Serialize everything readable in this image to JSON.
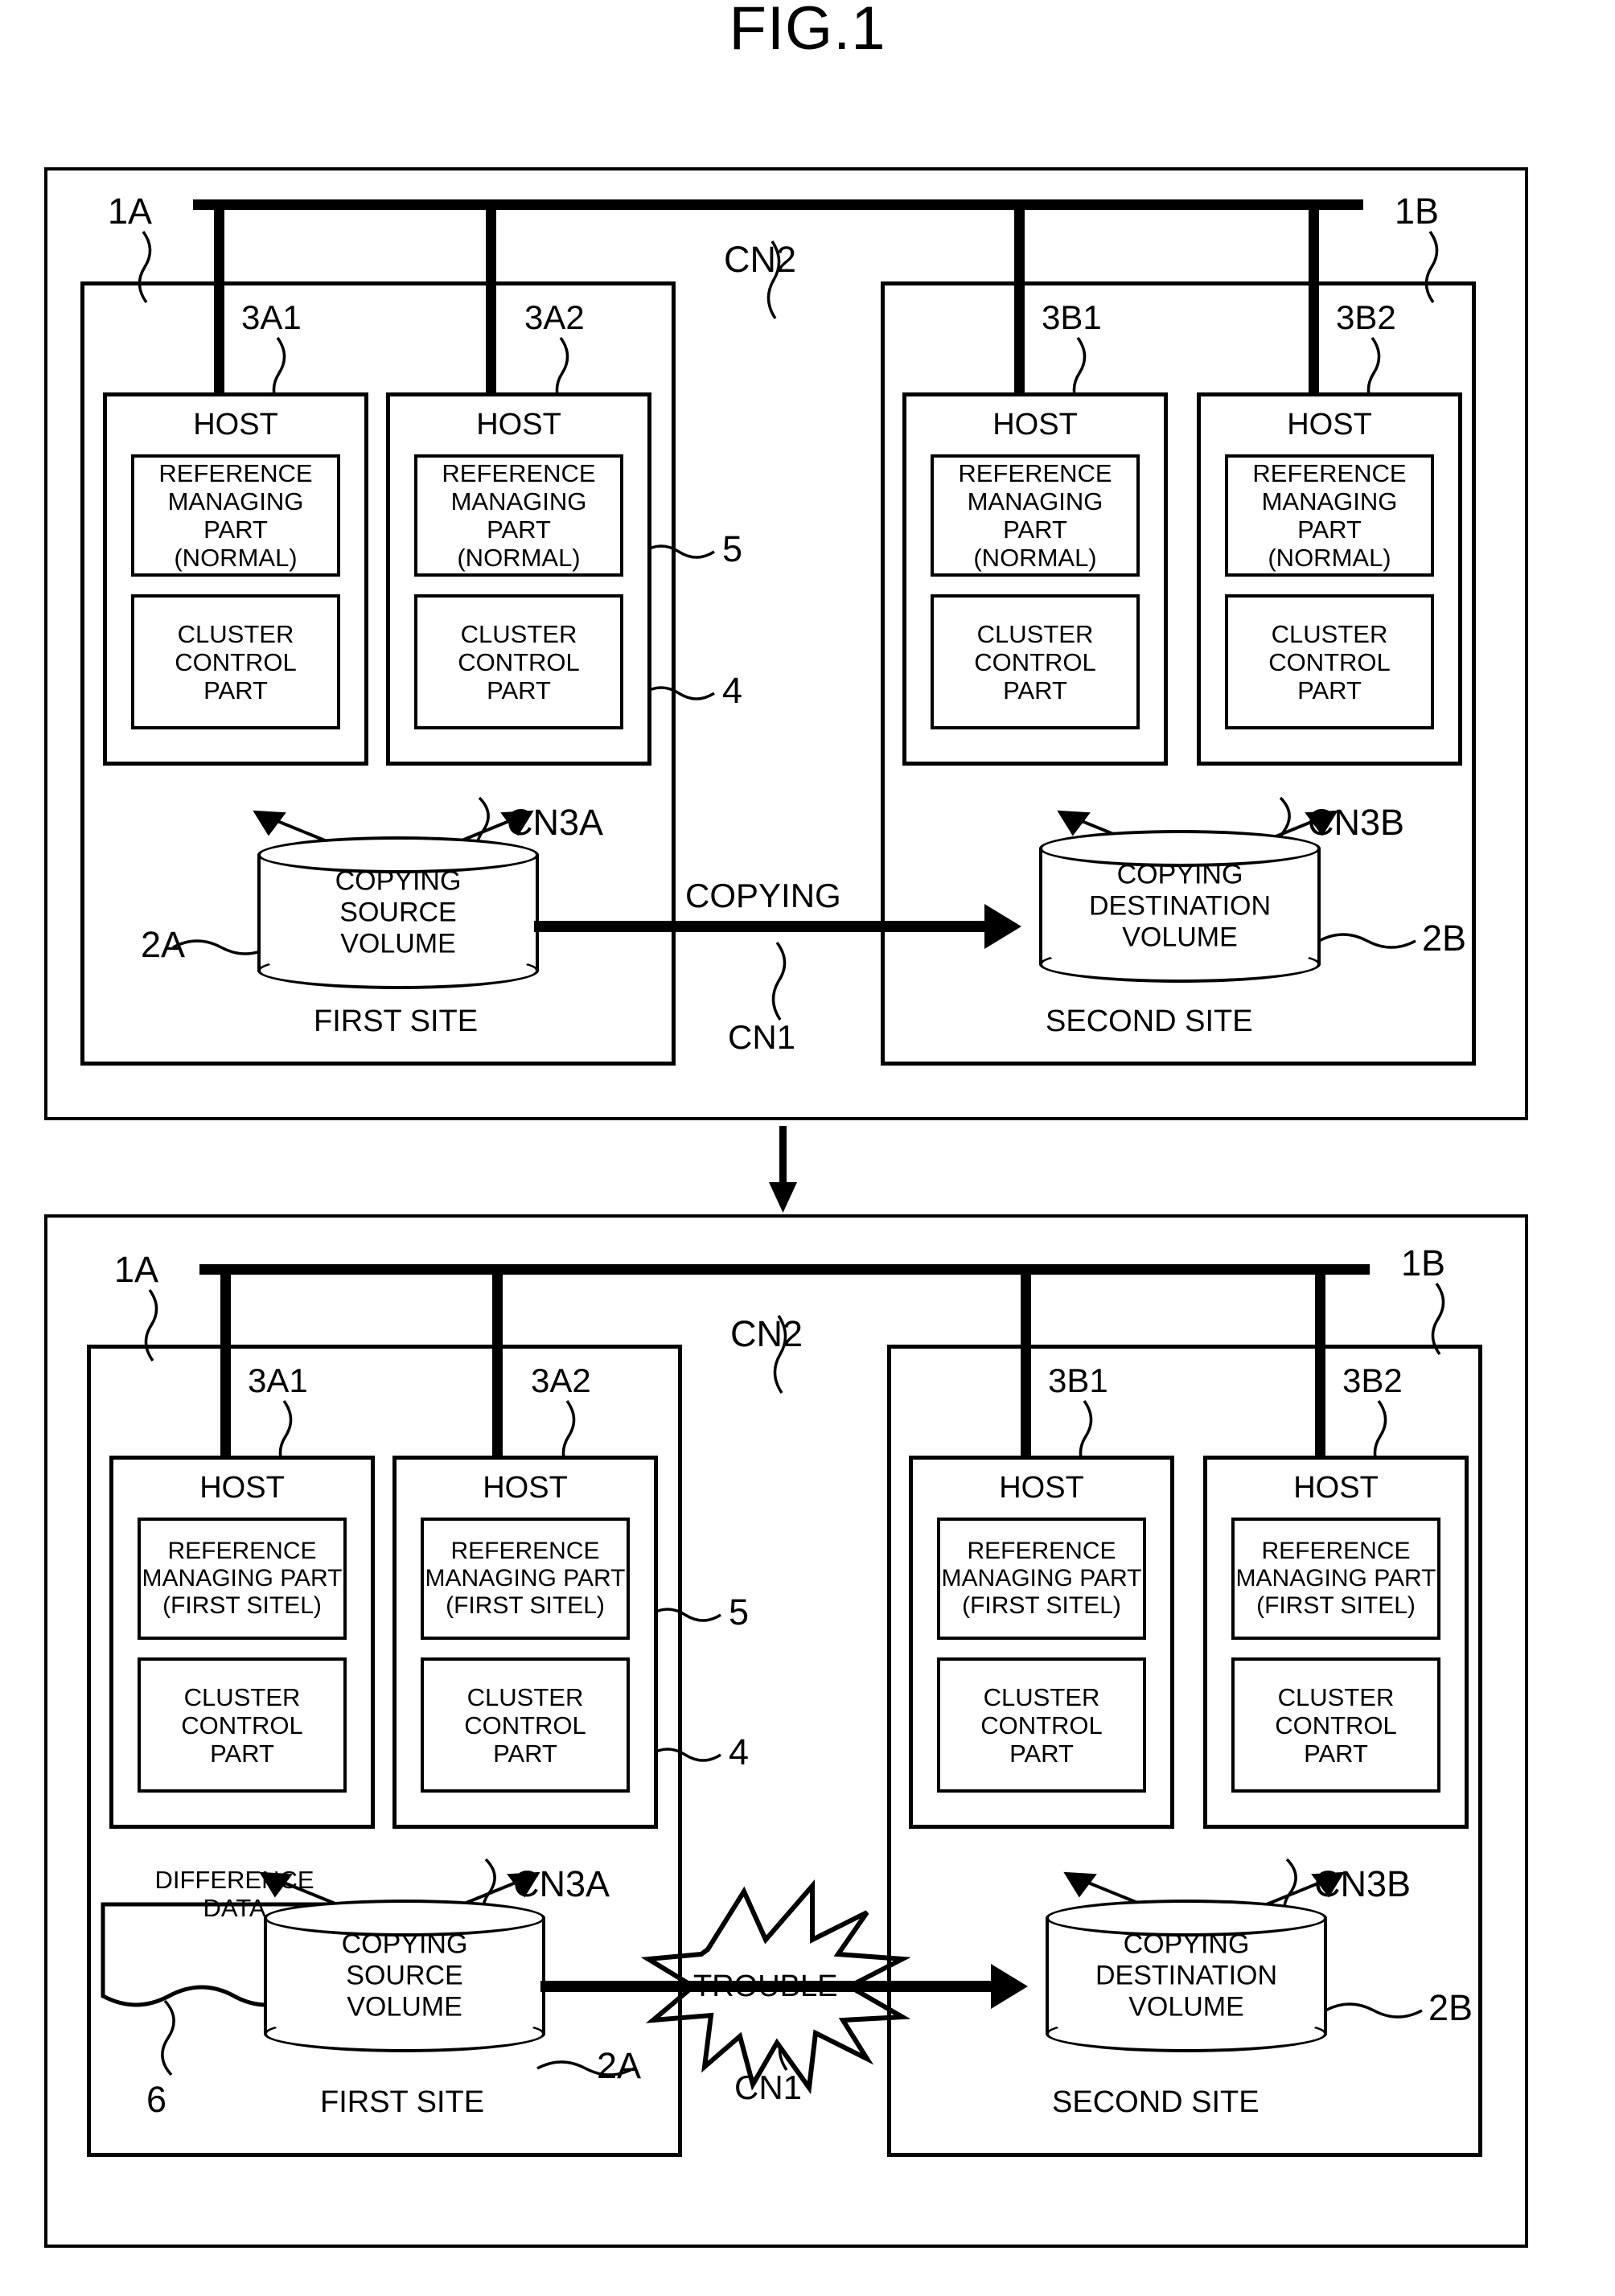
{
  "figure": {
    "title": "FIG.1"
  },
  "labels": {
    "system_a": "1A",
    "system_b": "1B",
    "host_a1": "3A1",
    "host_a2": "3A2",
    "host_b1": "3B1",
    "host_b2": "3B2",
    "network_cn2": "CN2",
    "network_cn1": "CN1",
    "network_cn3a": "CN3A",
    "network_cn3b": "CN3B",
    "ref_part_num": "5",
    "cluster_part_num": "4",
    "volume_2a": "2A",
    "volume_2b": "2B",
    "difference_num": "6"
  },
  "host": {
    "title": "HOST",
    "reference_managing_part": "REFERENCE\nMANAGING PART",
    "state_normal": "(NORMAL)",
    "state_first_site": "(FIRST SITEL)",
    "cluster_control_part": "CLUSTER\nCONTROL\nPART"
  },
  "volumes": {
    "source": "COPYING\nSOURCE\nVOLUME",
    "destination": "COPYING\nDESTINATION\nVOLUME"
  },
  "sites": {
    "first": "FIRST SITE",
    "second": "SECOND SITE"
  },
  "annotations": {
    "copying": "COPYING",
    "trouble": "TROUBLE",
    "difference_data": "DIFFERENCE\nDATA"
  }
}
